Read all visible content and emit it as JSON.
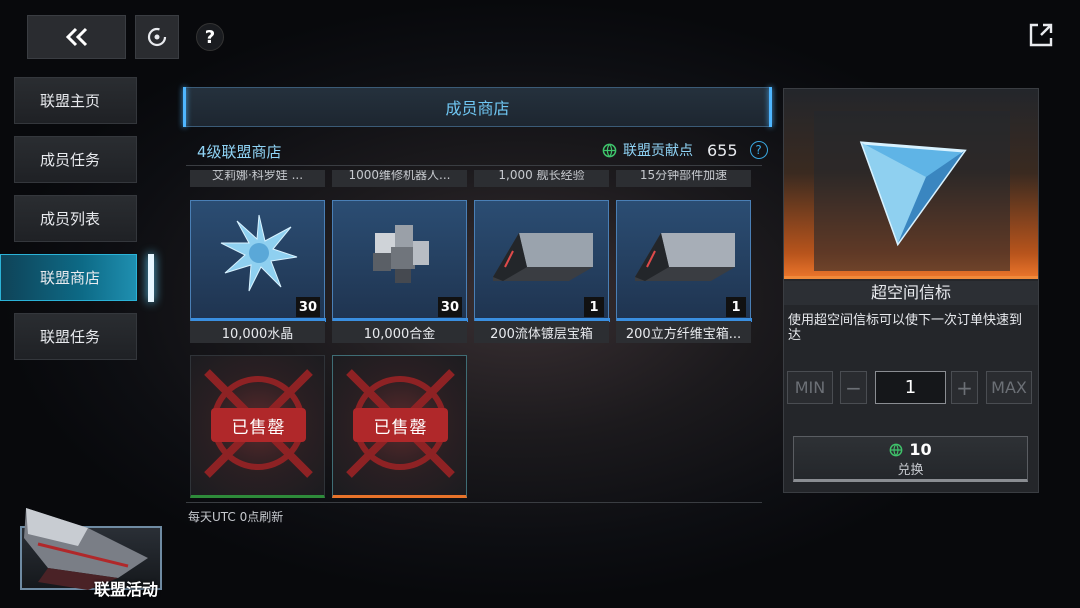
{
  "topbar": {
    "back_icon": "double-chevron-left-icon",
    "target_icon": "target-icon",
    "help_label": "?",
    "external_icon": "external-link-icon"
  },
  "sidebar": {
    "items": [
      {
        "label": "联盟主页"
      },
      {
        "label": "成员任务"
      },
      {
        "label": "成员列表"
      },
      {
        "label": "联盟商店",
        "active": true
      },
      {
        "label": "联盟任务"
      }
    ]
  },
  "shop": {
    "title": "成员商店",
    "level_label": "4级联盟商店",
    "points_label": "联盟贡献点",
    "points_value": "655",
    "help_label": "?",
    "partial_row": [
      "艾莉娜·科罗娃 ...",
      "1000维修机器人...",
      "1,000 舰长经验",
      "15分钟部件加速"
    ],
    "items": [
      {
        "name": "10,000水晶",
        "qty": "30",
        "icon": "crystal-icon"
      },
      {
        "name": "10,000合金",
        "qty": "30",
        "icon": "alloy-icon"
      },
      {
        "name": "200流体镀层宝箱",
        "qty": "1",
        "icon": "chest-icon"
      },
      {
        "name": "200立方纤维宝箱...",
        "qty": "1",
        "icon": "chest-icon"
      }
    ],
    "sold_out": [
      {
        "stamp": "已售罄"
      },
      {
        "stamp": "已售罄"
      }
    ],
    "refresh_note": "每天UTC 0点刷新"
  },
  "detail": {
    "item_name": "超空间信标",
    "description": "使用超空间信标可以使下一次订单快速到达",
    "min_label": "MIN",
    "minus_label": "−",
    "quantity": "1",
    "plus_label": "+",
    "max_label": "MAX",
    "cost": "10",
    "redeem_label": "兑换"
  },
  "activity": {
    "label": "联盟活动"
  },
  "colors": {
    "accent": "#2bb3d8",
    "sold_red": "#b0282a",
    "detail_orange": "#e8732a"
  }
}
